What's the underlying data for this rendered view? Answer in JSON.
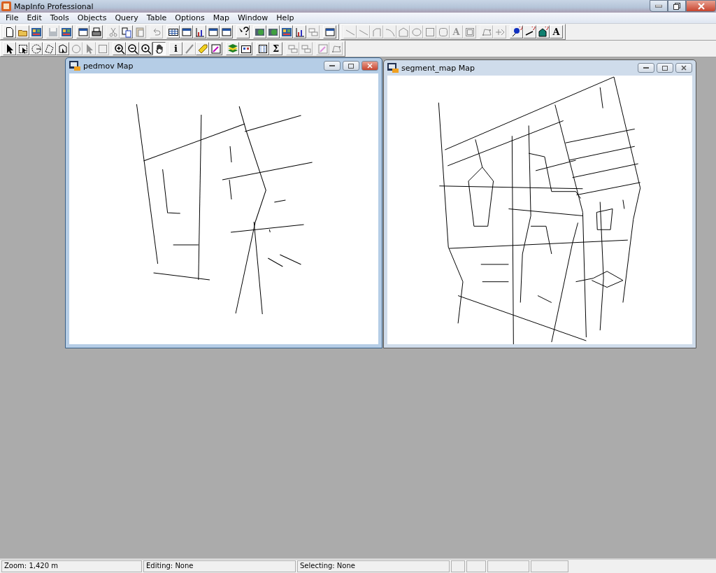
{
  "app_title": "MapInfo Professional",
  "menu": [
    {
      "label": "File"
    },
    {
      "label": "Edit"
    },
    {
      "label": "Tools"
    },
    {
      "label": "Objects"
    },
    {
      "label": "Query"
    },
    {
      "label": "Table"
    },
    {
      "label": "Options"
    },
    {
      "label": "Map"
    },
    {
      "label": "Window"
    },
    {
      "label": "Help"
    }
  ],
  "toolbars": [
    {
      "sets": [
        {
          "groups": [
            [
              {
                "disabled": false
              },
              {
                "disabled": false
              },
              {
                "disabled": false
              }
            ],
            [
              {
                "disabled": true
              },
              {
                "disabled": false
              }
            ],
            [
              {
                "disabled": false
              },
              {
                "disabled": false
              }
            ],
            [
              {
                "disabled": true
              },
              {
                "disabled": false
              },
              {
                "disabled": true
              }
            ],
            [
              {
                "disabled": true
              }
            ],
            [
              {
                "disabled": false
              },
              {
                "disabled": false
              },
              {
                "disabled": false
              },
              {
                "disabled": false
              },
              {
                "disabled": false
              }
            ],
            [
              {
                "disabled": false
              }
            ],
            [
              {
                "disabled": false
              },
              {
                "disabled": false
              },
              {
                "disabled": false
              },
              {
                "disabled": false
              },
              {
                "disabled": true
              }
            ],
            [
              {
                "disabled": false
              }
            ]
          ]
        },
        {
          "groups": [
            [
              {
                "disabled": true
              },
              {
                "disabled": true
              },
              {
                "disabled": true
              },
              {
                "disabled": true
              },
              {
                "disabled": true
              },
              {
                "disabled": true
              },
              {
                "disabled": true
              },
              {
                "disabled": true
              },
              {
                "disabled": true,
                "glyph": "A"
              },
              {
                "disabled": true
              }
            ],
            [
              {
                "disabled": true
              },
              {
                "disabled": true
              }
            ],
            [
              {
                "disabled": false
              },
              {
                "disabled": false
              },
              {
                "disabled": false
              },
              {
                "disabled": false,
                "glyph": "A"
              }
            ]
          ]
        }
      ]
    },
    {
      "sets": [
        {
          "groups": [
            [
              {
                "disabled": false,
                "pressed": false
              },
              {
                "disabled": false,
                "pressed": false
              },
              {
                "disabled": false,
                "pressed": false
              },
              {
                "disabled": false,
                "pressed": false
              },
              {
                "disabled": false,
                "pressed": false
              },
              {
                "disabled": true,
                "pressed": false
              },
              {
                "disabled": true,
                "pressed": false
              },
              {
                "disabled": true,
                "pressed": false
              }
            ],
            [
              {
                "disabled": false,
                "pressed": false
              },
              {
                "disabled": false,
                "pressed": false
              },
              {
                "disabled": false,
                "pressed": false
              },
              {
                "disabled": false,
                "pressed": true
              }
            ],
            [
              {
                "disabled": false,
                "pressed": false,
                "glyph": "i"
              },
              {
                "disabled": true,
                "pressed": false
              },
              {
                "disabled": false,
                "pressed": false
              },
              {
                "disabled": false,
                "pressed": false
              }
            ],
            [
              {
                "disabled": false,
                "pressed": false
              },
              {
                "disabled": false,
                "pressed": false
              }
            ],
            [
              {
                "disabled": false,
                "pressed": false
              },
              {
                "disabled": false,
                "pressed": false,
                "glyph": "Σ"
              }
            ],
            [
              {
                "disabled": true,
                "pressed": false
              },
              {
                "disabled": true,
                "pressed": false
              }
            ],
            [
              {
                "disabled": true,
                "pressed": false
              },
              {
                "disabled": true,
                "pressed": false
              }
            ]
          ]
        }
      ]
    }
  ],
  "windows": [
    {
      "title": "pedmov Map",
      "active": true
    },
    {
      "title": "segment_map Map",
      "active": false
    }
  ],
  "status_bar": [
    {
      "text": "Zoom: 1,420 m"
    },
    {
      "text": "Editing: None"
    },
    {
      "text": "Selecting: None"
    }
  ]
}
